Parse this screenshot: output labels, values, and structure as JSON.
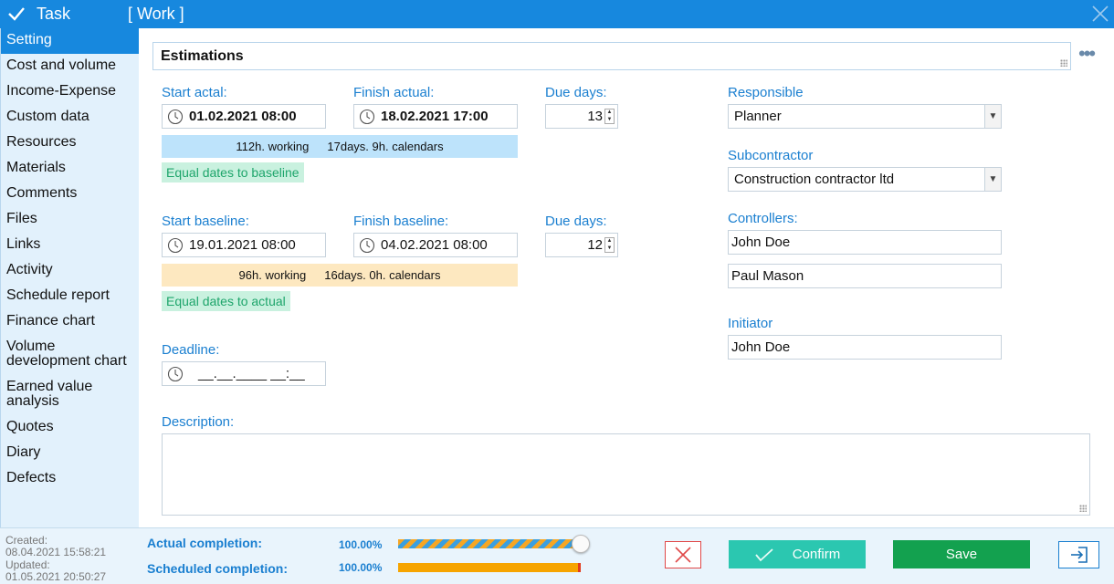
{
  "window": {
    "title": "Task",
    "subtitle": "[ Work ]"
  },
  "sidebar": {
    "items": [
      {
        "label": "Setting"
      },
      {
        "label": "Cost and volume"
      },
      {
        "label": "Income-Expense"
      },
      {
        "label": "Custom data"
      },
      {
        "label": "Resources"
      },
      {
        "label": "Materials"
      },
      {
        "label": "Comments"
      },
      {
        "label": "Files"
      },
      {
        "label": "Links"
      },
      {
        "label": "Activity"
      },
      {
        "label": "Schedule report"
      },
      {
        "label": "Finance chart"
      },
      {
        "label": "Volume development chart"
      },
      {
        "label": "Earned value analysis"
      },
      {
        "label": "Quotes"
      },
      {
        "label": "Diary"
      },
      {
        "label": "Defects"
      }
    ]
  },
  "estimations": {
    "title": "Estimations"
  },
  "actual": {
    "start_label": "Start actal:",
    "start_value": "01.02.2021 08:00",
    "finish_label": "Finish actual:",
    "finish_value": "18.02.2021 17:00",
    "due_label": "Due days:",
    "due_value": "13",
    "working": "112h. working",
    "calendars": "17days. 9h. calendars",
    "badge": "Equal dates to baseline"
  },
  "baseline": {
    "start_label": "Start baseline:",
    "start_value": "19.01.2021 08:00",
    "finish_label": "Finish baseline:",
    "finish_value": "04.02.2021 08:00",
    "due_label": "Due days:",
    "due_value": "12",
    "working": "96h. working",
    "calendars": "16days. 0h. calendars",
    "badge": "Equal dates to actual"
  },
  "deadline": {
    "label": "Deadline:",
    "value": "__.__.____ __:__"
  },
  "description": {
    "label": "Description:",
    "value": ""
  },
  "responsible": {
    "label": "Responsible",
    "value": "Planner"
  },
  "subcontractor": {
    "label": "Subcontractor",
    "value": "Construction contractor ltd"
  },
  "controllers": {
    "label": "Controllers:",
    "items": [
      "John Doe",
      "Paul Mason"
    ]
  },
  "initiator": {
    "label": "Initiator",
    "value": "John Doe"
  },
  "footer": {
    "created_label": "Created:",
    "created_value": "08.04.2021 15:58:21",
    "updated_label": "Updated:",
    "updated_value": "01.05.2021 20:50:27",
    "actual_completion_label": "Actual completion:",
    "actual_completion_value": "100.00%",
    "actual_completion_fraction": 1.0,
    "scheduled_completion_label": "Scheduled completion:",
    "scheduled_completion_value": "100.00%",
    "scheduled_completion_fraction": 1.0,
    "confirm_label": "Confirm",
    "save_label": "Save"
  },
  "colors": {
    "accent": "#1788de",
    "label_blue": "#1a7fd0",
    "confirm": "#2bc7b0",
    "save": "#13a14f",
    "progress_orange": "#f6a400"
  },
  "icons": {
    "window": "check-icon",
    "close": "close-icon",
    "date": "clock-icon",
    "more": "more-dots-icon",
    "cancel": "x-icon",
    "confirm": "checkmark-icon",
    "exit": "exit-icon"
  }
}
